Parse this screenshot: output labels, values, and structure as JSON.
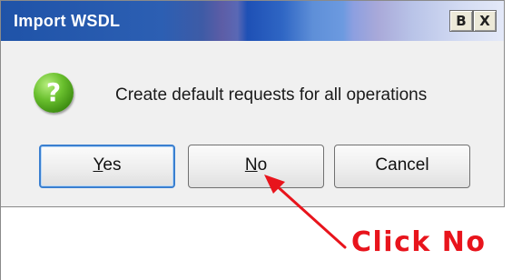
{
  "window": {
    "title": "Import WSDL",
    "restore_glyph": "B",
    "close_glyph": "X"
  },
  "dialog": {
    "icon": "question-icon",
    "icon_glyph": "?",
    "message": "Create default requests for all operations",
    "default_button": "yes"
  },
  "buttons": {
    "yes": {
      "mnemonic": "Y",
      "rest": "es"
    },
    "no": {
      "mnemonic": "N",
      "rest": "o"
    },
    "cancel": "Cancel"
  },
  "annotation": {
    "text": "Click No",
    "color": "#e8141c",
    "points_to": "no-button"
  },
  "colors": {
    "title_bar_start": "#1f53a8",
    "title_bar_end": "#e4e9f8",
    "dialog_background": "#f0f0f0",
    "default_button_border": "#3a7fd0",
    "icon_green": "#6ac02e"
  }
}
